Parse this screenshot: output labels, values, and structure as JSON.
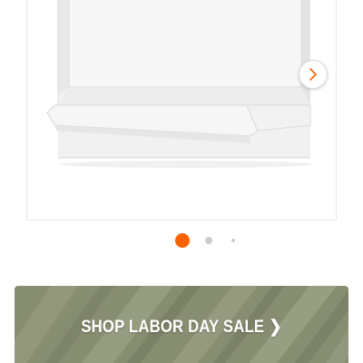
{
  "carousel": {
    "next_icon": "chevron-right-icon",
    "dots_count": 3,
    "active_index": 0,
    "active_color": "#f96302",
    "inactive_color": "#cccccc"
  },
  "promo": {
    "label": "SHOP LABOR DAY SALE",
    "chevron": "❯",
    "bg_color": "#8c9275"
  }
}
